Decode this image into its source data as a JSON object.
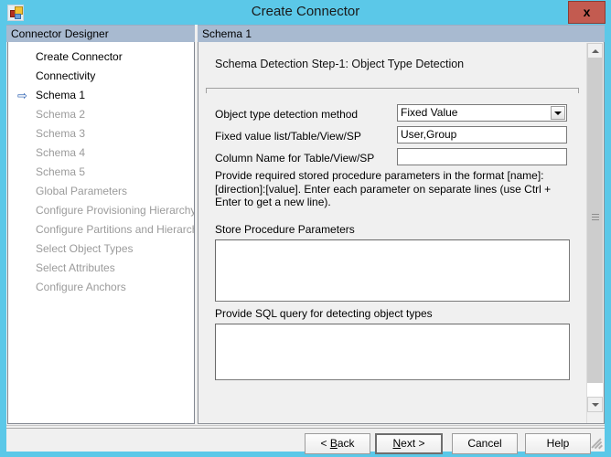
{
  "window": {
    "title": "Create Connector",
    "close_label": "x",
    "icon": "connector-app-icon"
  },
  "panes": {
    "left_header": "Connector Designer",
    "right_header": "Schema 1"
  },
  "sidebar": {
    "items": [
      {
        "label": "Create Connector",
        "state": "done",
        "arrow": ""
      },
      {
        "label": "Connectivity",
        "state": "done",
        "arrow": ""
      },
      {
        "label": "Schema 1",
        "state": "active",
        "arrow": "⇨"
      },
      {
        "label": "Schema 2",
        "state": "disabled",
        "arrow": ""
      },
      {
        "label": "Schema 3",
        "state": "disabled",
        "arrow": ""
      },
      {
        "label": "Schema 4",
        "state": "disabled",
        "arrow": ""
      },
      {
        "label": "Schema 5",
        "state": "disabled",
        "arrow": ""
      },
      {
        "label": "Global Parameters",
        "state": "disabled",
        "arrow": ""
      },
      {
        "label": "Configure Provisioning Hierarchy",
        "state": "disabled",
        "arrow": ""
      },
      {
        "label": "Configure Partitions and Hierarchies",
        "state": "disabled",
        "arrow": ""
      },
      {
        "label": "Select Object Types",
        "state": "disabled",
        "arrow": ""
      },
      {
        "label": "Select Attributes",
        "state": "disabled",
        "arrow": ""
      },
      {
        "label": "Configure Anchors",
        "state": "disabled",
        "arrow": ""
      }
    ]
  },
  "content": {
    "step_heading": "Schema Detection Step-1: Object Type Detection",
    "fields": {
      "detection_method_label": "Object type detection method",
      "detection_method_value": "Fixed Value",
      "fixed_value_label": "Fixed value list/Table/View/SP",
      "fixed_value_value": "User,Group",
      "column_name_label": "Column Name for Table/View/SP",
      "column_name_value": ""
    },
    "note": "Provide required stored procedure parameters in the format [name]:[direction]:[value]. Enter each parameter on separate lines (use Ctrl + Enter to get a new line).",
    "sp_params_label": "Store Procedure Parameters",
    "sp_params_value": "",
    "sql_query_label": "Provide SQL query for detecting object types",
    "sql_query_value": ""
  },
  "footer": {
    "back": "< Back",
    "back_pre": "< ",
    "back_accel": "B",
    "back_post": "ack",
    "next_pre": "",
    "next_accel": "N",
    "next_post": "ext >",
    "cancel": "Cancel",
    "help": "Help"
  },
  "colors": {
    "titlebar": "#5bc8e8",
    "header_strip": "#a8bad0",
    "close_button": "#c35b50",
    "panel_bg": "#f0f0f0",
    "nav_arrow": "#2a5fb0",
    "disabled_text": "#9b9b9b"
  }
}
